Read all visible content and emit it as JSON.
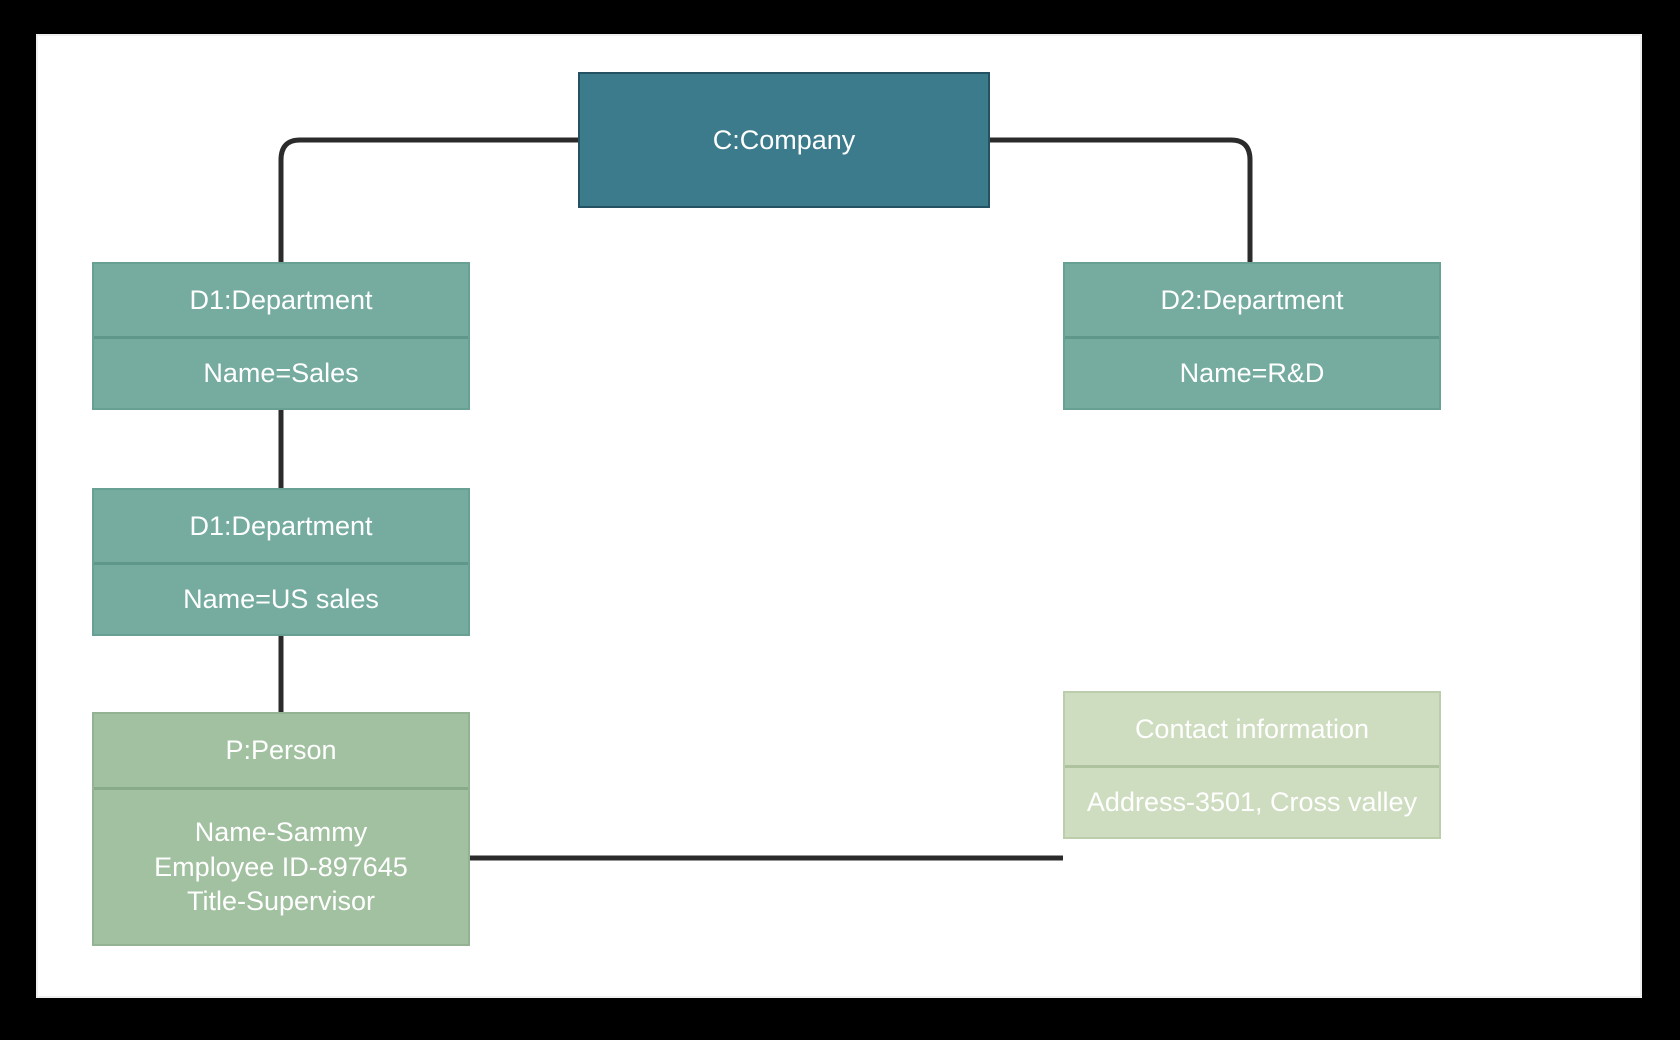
{
  "diagram": {
    "type": "uml-object-diagram",
    "background_color": "#000000",
    "canvas_color": "#ffffff",
    "connector_color": "#2b2b2b"
  },
  "nodes": {
    "company": {
      "title": "C:Company",
      "fill": "#3b7b8c",
      "border": "#245263"
    },
    "department_sales": {
      "title": "D1:Department",
      "attribute": "Name=Sales",
      "fill": "#75ac9f",
      "border": "#68a093"
    },
    "department_rnd": {
      "title": "D2:Department",
      "attribute": "Name=R&D",
      "fill": "#75ac9f",
      "border": "#68a093"
    },
    "department_us_sales": {
      "title": "D1:Department",
      "attribute": "Name=US sales",
      "fill": "#75ac9f",
      "border": "#68a093"
    },
    "person": {
      "title": "P:Person",
      "attributes": "Name-Sammy\nEmployee ID-897645\nTitle-Supervisor",
      "fill": "#a2c1a1",
      "border": "#93b393"
    },
    "contact": {
      "title": "Contact information",
      "attribute": "Address-3501, Cross valley",
      "fill": "#cedcbf",
      "border": "#bccdac"
    }
  },
  "connections": [
    {
      "from": "company",
      "to": "department_sales"
    },
    {
      "from": "company",
      "to": "department_rnd"
    },
    {
      "from": "department_sales",
      "to": "department_us_sales"
    },
    {
      "from": "department_us_sales",
      "to": "person"
    },
    {
      "from": "person",
      "to": "contact"
    }
  ]
}
